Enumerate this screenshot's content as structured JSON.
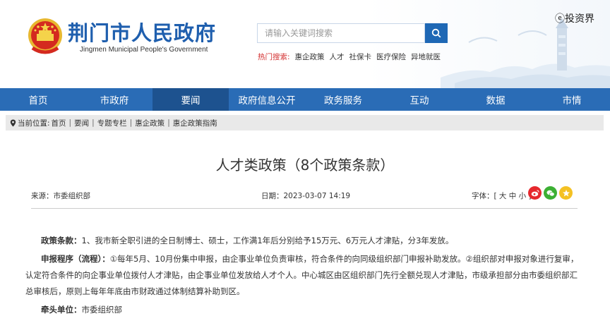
{
  "header": {
    "title": "荆门市人民政府",
    "subtitle": "Jingmen Municipal People's Government",
    "watermark": "ⓔ投资界"
  },
  "search": {
    "placeholder": "请输入关键词搜索",
    "hot_label": "热门搜索:",
    "hot_items": [
      "惠企政策",
      "人才",
      "社保卡",
      "医疗保险",
      "异地就医"
    ]
  },
  "nav": {
    "items": [
      "首页",
      "市政府",
      "要闻",
      "政府信息公开",
      "政务服务",
      "互动",
      "数据",
      "市情"
    ],
    "active_index": 2
  },
  "breadcrumb": {
    "label": "当前位置:",
    "items": [
      "首页",
      "要闻",
      "专题专栏",
      "惠企政策",
      "惠企政策指南"
    ],
    "separator": "|"
  },
  "article": {
    "title": "人才类政策（8个政策条款）",
    "source": "来源：市委组织部",
    "date": "日期：2023-03-07 14:19",
    "font_size_label": "字体：[ 大 中 小 ]",
    "paragraphs": [
      {
        "label": "政策条款：",
        "text": "1、我市新全职引进的全日制博士、硕士，工作满1年后分别给予15万元、6万元人才津贴，分3年发放。"
      },
      {
        "label": "申报程序（流程）：",
        "text": "①每年5月、10月份集中申报，由企事业单位负责审核，符合条件的向同级组织部门申报补助发放。②组织部对申报对象进行复审，认定符合条件的向企事业单位拨付人才津贴，由企事业单位发放给人才个人。中心城区由区组织部门先行全额兑现人才津贴，市级承担部分由市委组织部汇总审核后，原则上每年年底由市财政通过体制结算补助到区。"
      },
      {
        "label": "牵头单位：",
        "text": "市委组织部"
      }
    ]
  },
  "colors": {
    "brand_blue": "#1f5fae",
    "nav_blue": "#2a6cb6",
    "nav_active": "#1d528f",
    "hot_red": "#d32f2f"
  },
  "icons": [
    "national-emblem-icon",
    "search-icon",
    "location-icon",
    "weibo-icon",
    "wechat-icon",
    "qzone-icon"
  ]
}
